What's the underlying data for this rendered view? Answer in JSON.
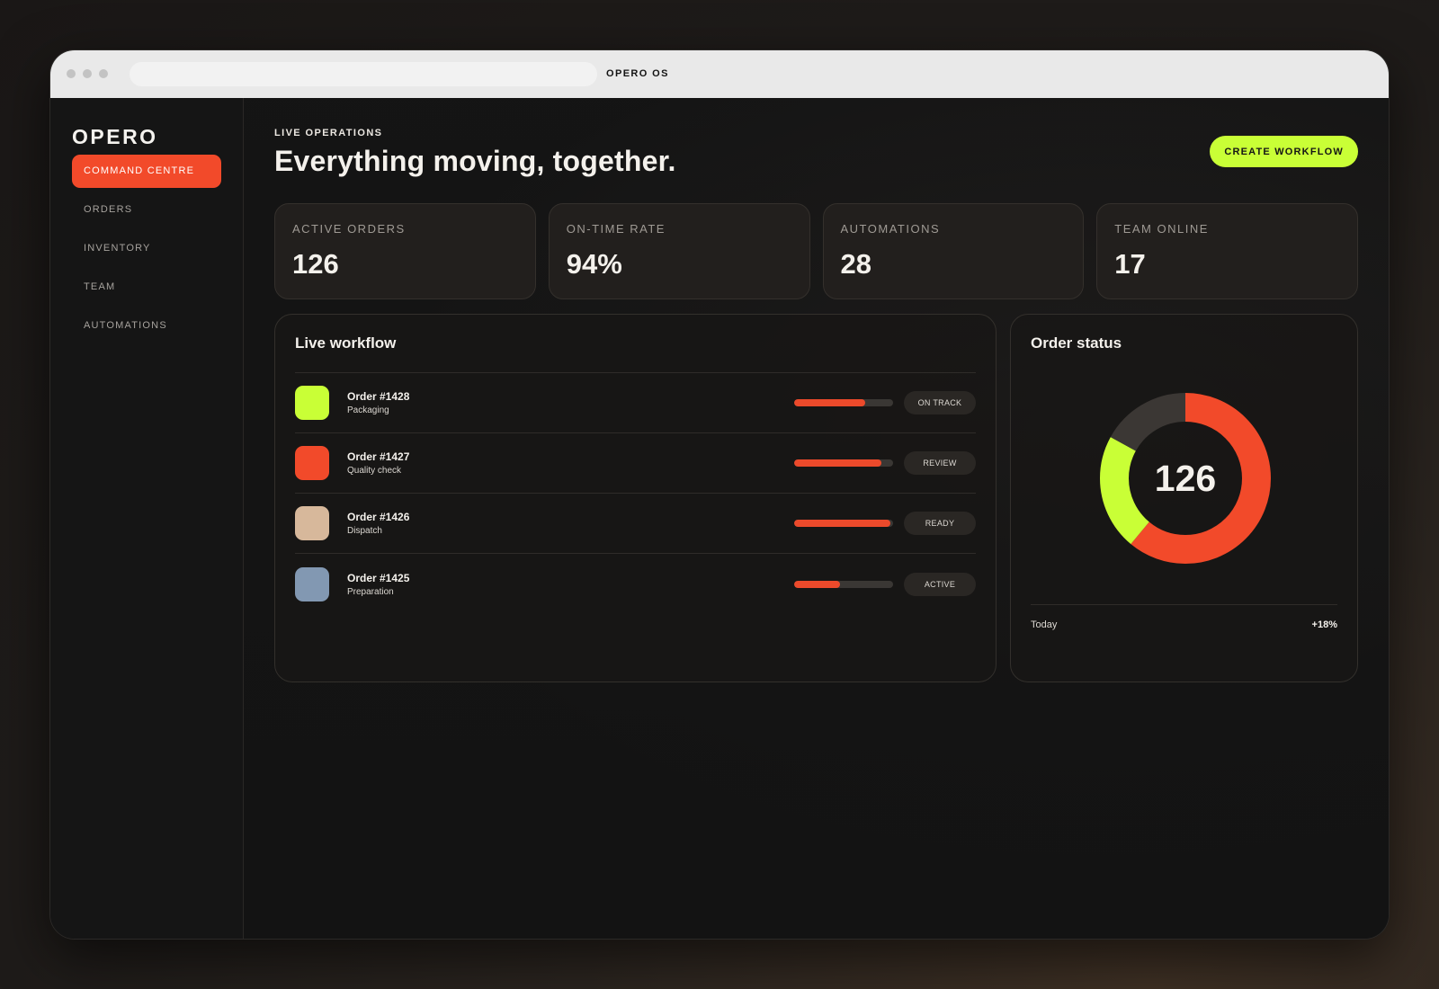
{
  "window": {
    "title": "OPERO OS"
  },
  "sidebar": {
    "logo": "OPERO",
    "items": [
      {
        "label": "COMMAND CENTRE",
        "active": true
      },
      {
        "label": "ORDERS",
        "active": false
      },
      {
        "label": "INVENTORY",
        "active": false
      },
      {
        "label": "TEAM",
        "active": false
      },
      {
        "label": "AUTOMATIONS",
        "active": false
      }
    ]
  },
  "header": {
    "kicker": "LIVE OPERATIONS",
    "title": "Everything moving, together.",
    "cta_label": "CREATE WORKFLOW"
  },
  "kpis": [
    {
      "label": "ACTIVE ORDERS",
      "value": "126"
    },
    {
      "label": "ON-TIME RATE",
      "value": "94%"
    },
    {
      "label": "AUTOMATIONS",
      "value": "28"
    },
    {
      "label": "TEAM ONLINE",
      "value": "17"
    }
  ],
  "workflow": {
    "title": "Live workflow",
    "rows": [
      {
        "order": "Order #1428",
        "stage": "Packaging",
        "color": "#c9ff36",
        "progress": 0.72,
        "status": "ON TRACK"
      },
      {
        "order": "Order #1427",
        "stage": "Quality check",
        "color": "#f24a2a",
        "progress": 0.88,
        "status": "REVIEW"
      },
      {
        "order": "Order #1426",
        "stage": "Dispatch",
        "color": "#d7b89b",
        "progress": 0.97,
        "status": "READY"
      },
      {
        "order": "Order #1425",
        "stage": "Preparation",
        "color": "#8298b2",
        "progress": 0.46,
        "status": "ACTIVE"
      }
    ]
  },
  "order_status": {
    "title": "Order status",
    "total": "126",
    "segments": [
      {
        "value": 0.61,
        "color": "#f24a2a"
      },
      {
        "value": 0.22,
        "color": "#c9ff36"
      },
      {
        "value": 0.17,
        "color": "#3b3734"
      }
    ],
    "foot_label": "Today",
    "foot_value": "+18%"
  },
  "colors": {
    "accent": "#f24a2a",
    "highlight": "#c9ff36"
  }
}
